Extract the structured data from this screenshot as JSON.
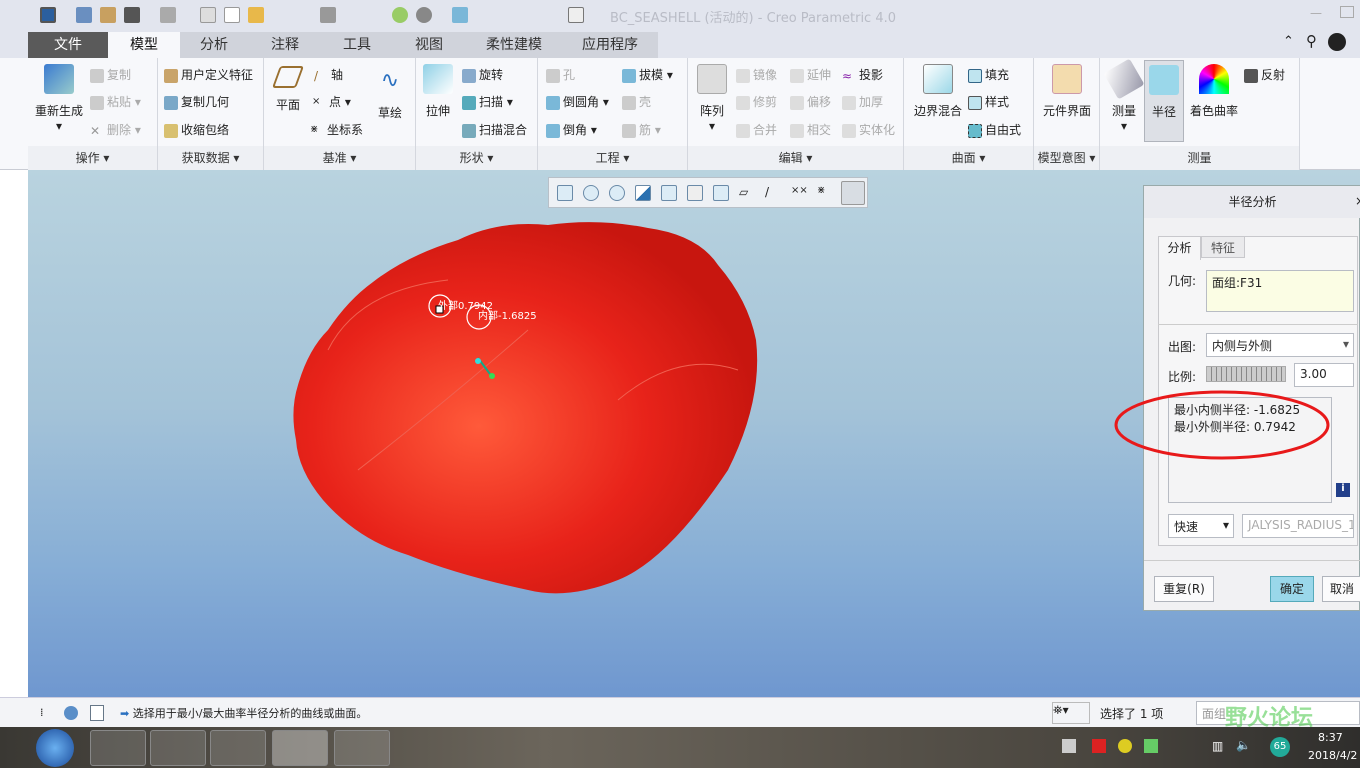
{
  "window": {
    "title": "BC_SEASHELL (活动的) - Creo Parametric 4.0"
  },
  "tabs": [
    {
      "label": "文件"
    },
    {
      "label": "模型"
    },
    {
      "label": "分析"
    },
    {
      "label": "注释"
    },
    {
      "label": "工具"
    },
    {
      "label": "视图"
    },
    {
      "label": "柔性建模"
    },
    {
      "label": "应用程序"
    }
  ],
  "ribbon": {
    "operations": {
      "label": "操作",
      "regen": "重新生成",
      "copy": "复制",
      "paste": "粘贴",
      "delete": "删除"
    },
    "getdata": {
      "label": "获取数据",
      "udf": "用户定义特征",
      "copygeom": "复制几何",
      "shrinkwrap": "收缩包络"
    },
    "datum": {
      "label": "基准",
      "plane": "平面",
      "axis": "轴",
      "point": "点",
      "csys": "坐标系",
      "sketch": "草绘"
    },
    "shapes": {
      "label": "形状",
      "extrude": "拉伸",
      "revolve": "旋转",
      "sweep": "扫描",
      "sweptblend": "扫描混合"
    },
    "engineering": {
      "label": "工程",
      "hole": "孔",
      "draft": "拔模",
      "round": "倒圆角",
      "shell": "壳",
      "chamfer": "倒角",
      "rib": "筋"
    },
    "editing": {
      "label": "编辑",
      "pattern": "阵列",
      "mirror": "镜像",
      "extend": "延伸",
      "project": "投影",
      "trim": "修剪",
      "offset": "偏移",
      "thicken": "加厚",
      "merge": "合并",
      "intersect": "相交",
      "solidify": "实体化"
    },
    "surfaces": {
      "label": "曲面",
      "boundary": "边界混合",
      "fill": "填充",
      "style": "样式",
      "freestyle": "自由式"
    },
    "intent": {
      "label": "模型意图",
      "component": "元件界面"
    },
    "measure": {
      "label": "测量",
      "measure": "测量",
      "radius": "半径",
      "curvature": "着色曲率",
      "reflection": "反射"
    }
  },
  "viewport": {
    "outer_label": "外部0.7942",
    "inner_label": "内部-1.6825"
  },
  "dialog": {
    "title": "半径分析",
    "tabs": [
      "分析",
      "特征"
    ],
    "geom_label": "几何:",
    "geom_value": "面组:F31",
    "plot_label": "出图:",
    "plot_value": "内侧与外侧",
    "scale_label": "比例:",
    "scale_value": "3.00",
    "result_line1": "最小内侧半径: -1.6825",
    "result_line2": "最小外侧半径: 0.7942",
    "mode_value": "快速",
    "name_value": "JALYSIS_RADIUS_1",
    "repeat": "重复(R)",
    "ok": "确定",
    "cancel": "取消"
  },
  "status": {
    "message": "选择用于最小/最大曲率半径分析的曲线或曲面。",
    "selected": "选择了 1 项",
    "filter": "面组"
  },
  "taskbar": {
    "time": "8:37",
    "date": "2018/4/2",
    "badge": "65"
  },
  "watermark": "野火论坛",
  "colors": {
    "model": "#e8231a",
    "annotation": "#e8191a",
    "accent": "#9ad7ea"
  }
}
